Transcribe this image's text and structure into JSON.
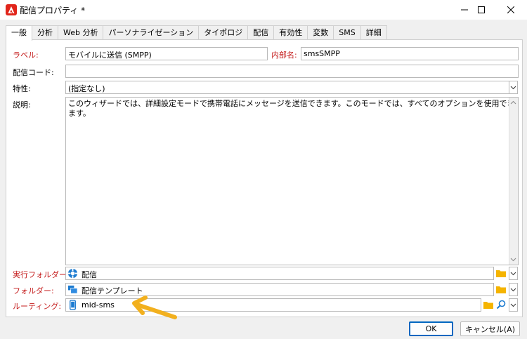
{
  "window": {
    "title": "配信プロパティ *",
    "controls": [
      "minimize",
      "maximize",
      "close"
    ]
  },
  "tabs": [
    {
      "label": "一般",
      "active": true
    },
    {
      "label": "分析",
      "active": false
    },
    {
      "label": "Web 分析",
      "active": false
    },
    {
      "label": "パーソナライゼーション",
      "active": false
    },
    {
      "label": "タイポロジ",
      "active": false
    },
    {
      "label": "配信",
      "active": false
    },
    {
      "label": "有効性",
      "active": false
    },
    {
      "label": "変数",
      "active": false
    },
    {
      "label": "SMS",
      "active": false
    },
    {
      "label": "詳細",
      "active": false
    }
  ],
  "form": {
    "label_caption": "ラベル:",
    "label_value": "モバイルに送信 (SMPP)",
    "internal_name_caption": "内部名:",
    "internal_name_value": "smsSMPP",
    "delivery_code_caption": "配信コード:",
    "delivery_code_value": "",
    "nature_caption": "特性:",
    "nature_value": "(指定なし)",
    "description_caption": "説明:",
    "description_value": "このウィザードでは、詳細設定モードで携帯電話にメッセージを送信できます。このモードでは、すべてのオプションを使用できます。",
    "execution_folder_caption": "実行フォルダー:",
    "execution_folder_value": "配信",
    "folder_caption": "フォルダー:",
    "folder_value": "配信テンプレート",
    "routing_caption": "ルーティング:",
    "routing_value": "mid-sms"
  },
  "buttons": {
    "ok": "OK",
    "cancel": "キャンセル(A)"
  },
  "colors": {
    "required_label": "#c41b1b",
    "accent": "#0067c0",
    "arrow": "#f2b01e",
    "folder": "#f5b400"
  }
}
